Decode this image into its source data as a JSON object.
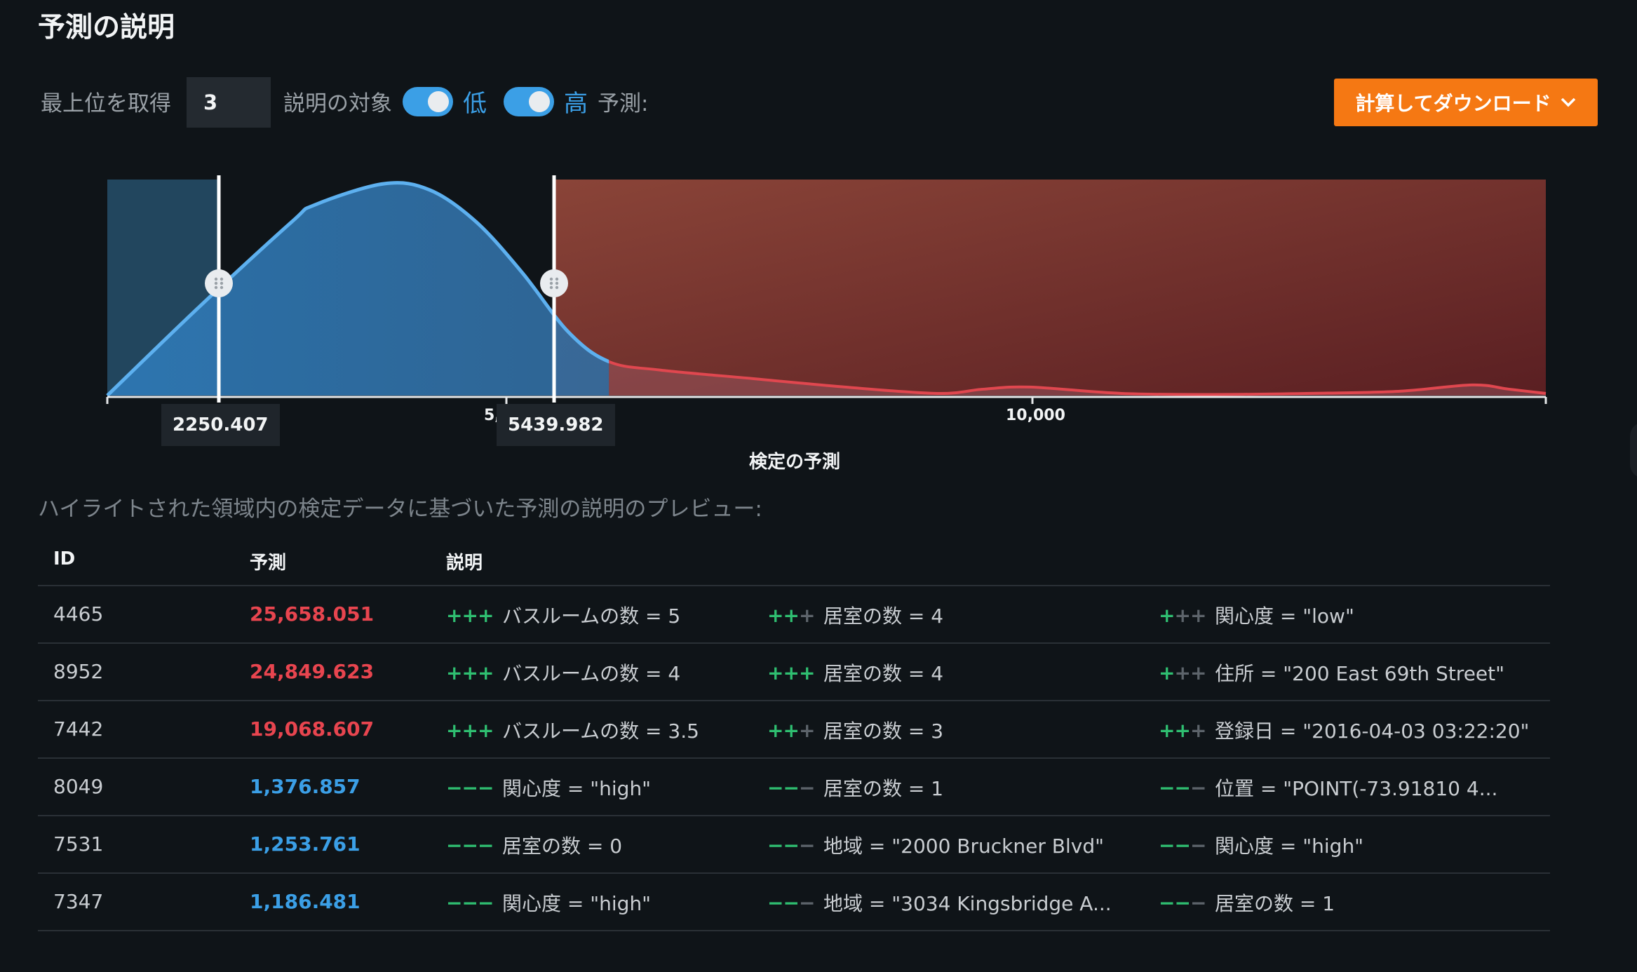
{
  "title": "予測の説明",
  "toolbar": {
    "top_n_label": "最上位を取得",
    "top_n_value": "3",
    "target_label": "説明の対象",
    "low_label": "低",
    "high_label": "高",
    "prediction_label": "予測:",
    "download_label": "計算してダウンロード",
    "accent_color": "#3b9fe6",
    "download_color": "#f57813"
  },
  "chart": {
    "xaxis_title": "検定の予測",
    "tick_mid": "5,",
    "tick_10000": "10,000",
    "low_threshold": "2250.407",
    "high_threshold": "5439.982"
  },
  "chart_data": {
    "type": "area",
    "title": "",
    "xlabel": "検定の予測",
    "xlim": [
      0,
      15600
    ],
    "x_ticks": [
      0,
      5000,
      10000
    ],
    "low_threshold": 2250.407,
    "high_threshold": 5439.982,
    "series": [
      {
        "x": [
          0,
          1000,
          2000,
          2250,
          3000,
          3500,
          4000,
          4500,
          5000,
          5440,
          6000,
          7000,
          8000,
          9000,
          9500,
          10000,
          11000,
          12000,
          13000,
          14000,
          14800,
          15200,
          15600
        ],
        "y": [
          0,
          0.42,
          0.82,
          0.9,
          1.0,
          0.97,
          0.82,
          0.58,
          0.3,
          0.16,
          0.12,
          0.08,
          0.04,
          0.01,
          0.03,
          0.04,
          0.01,
          0.005,
          0.01,
          0.02,
          0.05,
          0.03,
          0.01
        ]
      }
    ]
  },
  "preview_caption": "ハイライトされた領域内の検定データに基づいた予測の説明のプレビュー:",
  "table": {
    "headers": {
      "id": "ID",
      "pred": "予測",
      "expl": "説明"
    },
    "rows": [
      {
        "id": "4465",
        "pred": "25,658.051",
        "dir": "high",
        "e": [
          {
            "strength": 3,
            "text": "バスルームの数 = 5"
          },
          {
            "strength": 2,
            "text": "居室の数 = 4"
          },
          {
            "strength": 1,
            "text": "関心度 = \"low\""
          }
        ]
      },
      {
        "id": "8952",
        "pred": "24,849.623",
        "dir": "high",
        "e": [
          {
            "strength": 3,
            "text": "バスルームの数 = 4"
          },
          {
            "strength": 3,
            "text": "居室の数 = 4"
          },
          {
            "strength": 1,
            "text": "住所 = \"200 East 69th Street\""
          }
        ]
      },
      {
        "id": "7442",
        "pred": "19,068.607",
        "dir": "high",
        "e": [
          {
            "strength": 3,
            "text": "バスルームの数 = 3.5"
          },
          {
            "strength": 2,
            "text": "居室の数 = 3"
          },
          {
            "strength": 2,
            "text": "登録日 = \"2016-04-03 03:22:20\""
          }
        ]
      },
      {
        "id": "8049",
        "pred": "1,376.857",
        "dir": "low",
        "e": [
          {
            "strength": 3,
            "text": "関心度 = \"high\""
          },
          {
            "strength": 2,
            "text": "居室の数 = 1"
          },
          {
            "strength": 2,
            "text": "位置 = \"POINT(-73.91810 4..."
          }
        ]
      },
      {
        "id": "7531",
        "pred": "1,253.761",
        "dir": "low",
        "e": [
          {
            "strength": 3,
            "text": "居室の数 = 0"
          },
          {
            "strength": 2,
            "text": "地域 = \"2000 Bruckner Blvd\""
          },
          {
            "strength": 2,
            "text": "関心度 = \"high\""
          }
        ]
      },
      {
        "id": "7347",
        "pred": "1,186.481",
        "dir": "low",
        "e": [
          {
            "strength": 3,
            "text": "関心度 = \"high\""
          },
          {
            "strength": 2,
            "text": "地域 = \"3034 Kingsbridge A..."
          },
          {
            "strength": 2,
            "text": "居室の数 = 1"
          }
        ]
      }
    ],
    "colors": {
      "high": "#e8454f",
      "low": "#3b9fe6",
      "plus": "+",
      "minus": "−"
    }
  }
}
